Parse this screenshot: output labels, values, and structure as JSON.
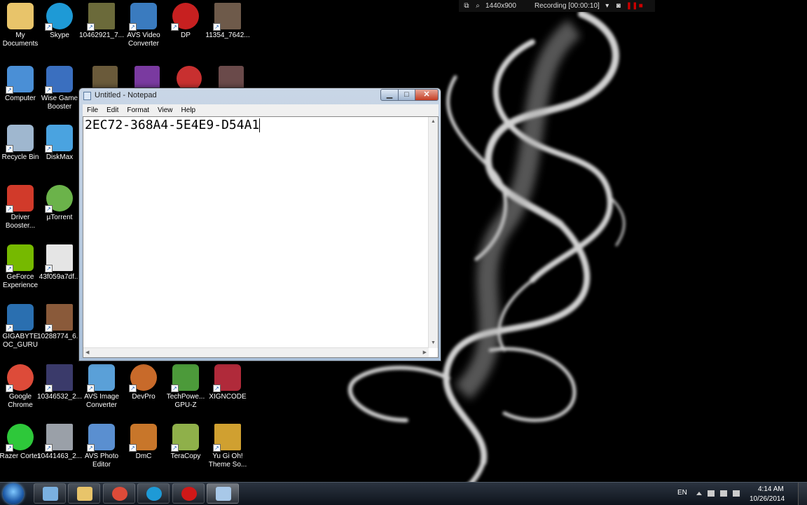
{
  "desktop": {
    "icons": [
      {
        "label": "My Documents",
        "icon": "folder-icon",
        "color": "#e8c46a"
      },
      {
        "label": "Skype",
        "icon": "skype-icon",
        "color": "#1e9ad6"
      },
      {
        "label": "10462921_7...",
        "icon": "image-thumbnail-icon",
        "color": "#6b6a3a"
      },
      {
        "label": "AVS Video Converter",
        "icon": "avs-video-converter-icon",
        "color": "#3a7bbf"
      },
      {
        "label": "DP",
        "icon": "dp-icon",
        "color": "#c72020"
      },
      {
        "label": "11354_7642...",
        "icon": "image-thumbnail-icon",
        "color": "#6e5a4a"
      },
      {
        "label": "Computer",
        "icon": "computer-icon",
        "color": "#4a8fd6"
      },
      {
        "label": "Wise Game Booster",
        "icon": "rocket-icon",
        "color": "#3a6fbf"
      },
      {
        "label": "Recycle Bin",
        "icon": "recycle-bin-icon",
        "color": "#9fb7cf"
      },
      {
        "label": "DiskMax",
        "icon": "diskmax-icon",
        "color": "#4aa3e0"
      },
      {
        "label": "Driver Booster...",
        "icon": "driver-booster-icon",
        "color": "#d13a2a"
      },
      {
        "label": "µTorrent",
        "icon": "utorrent-icon",
        "color": "#6bb34a"
      },
      {
        "label": "GeForce Experience",
        "icon": "geforce-icon",
        "color": "#76b900"
      },
      {
        "label": "43f059a7df...",
        "icon": "image-thumbnail-icon",
        "color": "#e5e5e5"
      },
      {
        "label": "GIGABYTE OC_GURU",
        "icon": "gigabyte-icon",
        "color": "#2a6fb0"
      },
      {
        "label": "10288774_6...",
        "icon": "image-thumbnail-icon",
        "color": "#8a5a3a"
      },
      {
        "label": "Google Chrome",
        "icon": "chrome-icon",
        "color": "#dd4b39"
      },
      {
        "label": "10346532_2...",
        "icon": "image-thumbnail-icon",
        "color": "#3a3a6a"
      },
      {
        "label": "AVS Image Converter",
        "icon": "avs-image-converter-icon",
        "color": "#5aa0d8"
      },
      {
        "label": "DevPro",
        "icon": "devpro-icon",
        "color": "#c86a2a"
      },
      {
        "label": "TechPowe... GPU-Z",
        "icon": "gpu-z-icon",
        "color": "#4c9a3a"
      },
      {
        "label": "XIGNCODE",
        "icon": "xigncode-icon",
        "color": "#b02a3a"
      },
      {
        "label": "Razer Cortex",
        "icon": "razer-icon",
        "color": "#2ec83a"
      },
      {
        "label": "10441463_2...",
        "icon": "image-thumbnail-icon",
        "color": "#9aa0a8"
      },
      {
        "label": "AVS Photo Editor",
        "icon": "avs-photo-editor-icon",
        "color": "#5a8fd0"
      },
      {
        "label": "DmC",
        "icon": "dmc-icon",
        "color": "#c8762a"
      },
      {
        "label": "TeraCopy",
        "icon": "teracopy-icon",
        "color": "#8fb04a"
      },
      {
        "label": "Yu Gi Oh! Theme So...",
        "icon": "image-thumbnail-icon",
        "color": "#d0a030"
      }
    ],
    "hidden_row_icons": [
      {
        "icon": "image-thumbnail-icon",
        "color": "#6a5a3a"
      },
      {
        "icon": "film-icon",
        "color": "#7a3aa0"
      },
      {
        "icon": "eye-icon",
        "color": "#c83030"
      },
      {
        "icon": "image-thumbnail-icon",
        "color": "#6a4a4a"
      }
    ]
  },
  "recorder": {
    "resolution": "1440x900",
    "status": "Recording [00:00:10]"
  },
  "notepad": {
    "title": "Untitled - Notepad",
    "menu": [
      "File",
      "Edit",
      "Format",
      "View",
      "Help"
    ],
    "content": "2EC72-368A4-5E4E9-D54A1",
    "min_glyph": "▁",
    "max_glyph": "□",
    "close_glyph": "✕"
  },
  "taskbar": {
    "buttons": [
      {
        "icon": "notepad-taskbar-icon",
        "color": "#7ab0e0"
      },
      {
        "icon": "explorer-taskbar-icon",
        "color": "#e8c46a"
      },
      {
        "icon": "chrome-taskbar-icon",
        "color": "#dd4b39"
      },
      {
        "icon": "skype-taskbar-icon",
        "color": "#1e9ad6"
      },
      {
        "icon": "record-taskbar-icon",
        "color": "#d01818"
      },
      {
        "icon": "notepad-active-taskbar-icon",
        "color": "#a8c8e8"
      }
    ],
    "language": "EN",
    "time": "4:14 AM",
    "date": "10/26/2014"
  },
  "colors": {
    "accent": "#1e9ad6",
    "close_red": "#c43c22"
  }
}
